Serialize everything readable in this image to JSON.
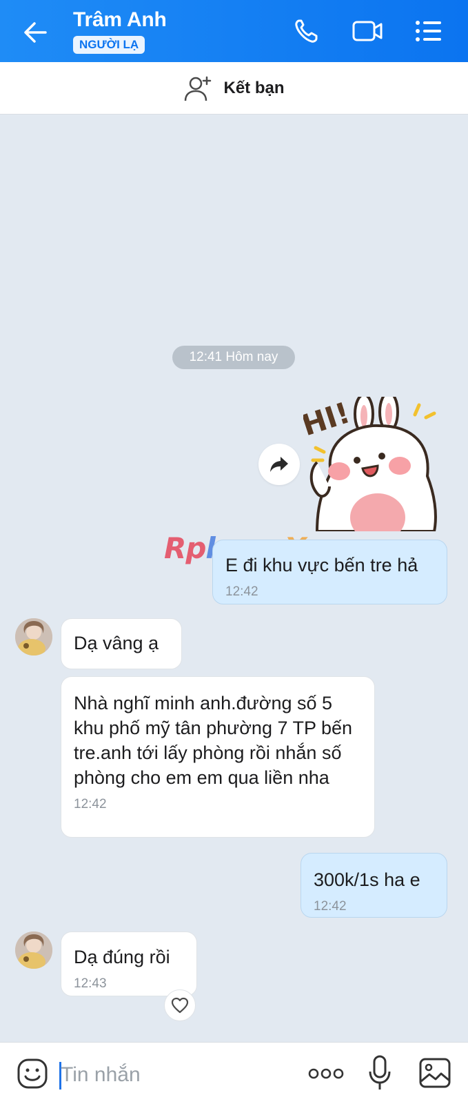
{
  "header": {
    "title": "Trâm Anh",
    "badge": "NGƯỜI LẠ",
    "bg_color": "#0b74f0"
  },
  "add_friend": {
    "label": "Kết bạn"
  },
  "conversation": {
    "date_chip": "12:41 Hôm nay",
    "watermark": {
      "part1": "Rp",
      "part2": "hang",
      "part3": "X"
    },
    "sticker": {
      "text": "HI!"
    },
    "messages": [
      {
        "side": "out",
        "text": "E đi khu vực bến tre hả",
        "time": "12:42"
      },
      {
        "side": "in",
        "text": "Dạ vâng ạ",
        "time": ""
      },
      {
        "side": "in",
        "text": "Nhà nghĩ minh anh.đường số 5 khu phố mỹ tân phường 7 TP bến tre.anh tới lấy phòng rồi nhắn số phòng cho em em qua liền nha",
        "time": "12:42"
      },
      {
        "side": "out",
        "text": "300k/1s ha e",
        "time": "12:42"
      },
      {
        "side": "in",
        "text": "Dạ đúng rồi",
        "time": "12:43"
      }
    ]
  },
  "input": {
    "placeholder": "Tin nhắn"
  },
  "icons": {
    "back": "back-arrow-icon",
    "call": "phone-icon",
    "video": "video-camera-icon",
    "menu": "menu-list-icon",
    "add_friend": "add-person-icon",
    "share": "share-forward-icon",
    "heart": "heart-icon",
    "emoji": "emoji-icon",
    "more": "more-dots-icon",
    "mic": "microphone-icon",
    "image": "image-icon"
  }
}
